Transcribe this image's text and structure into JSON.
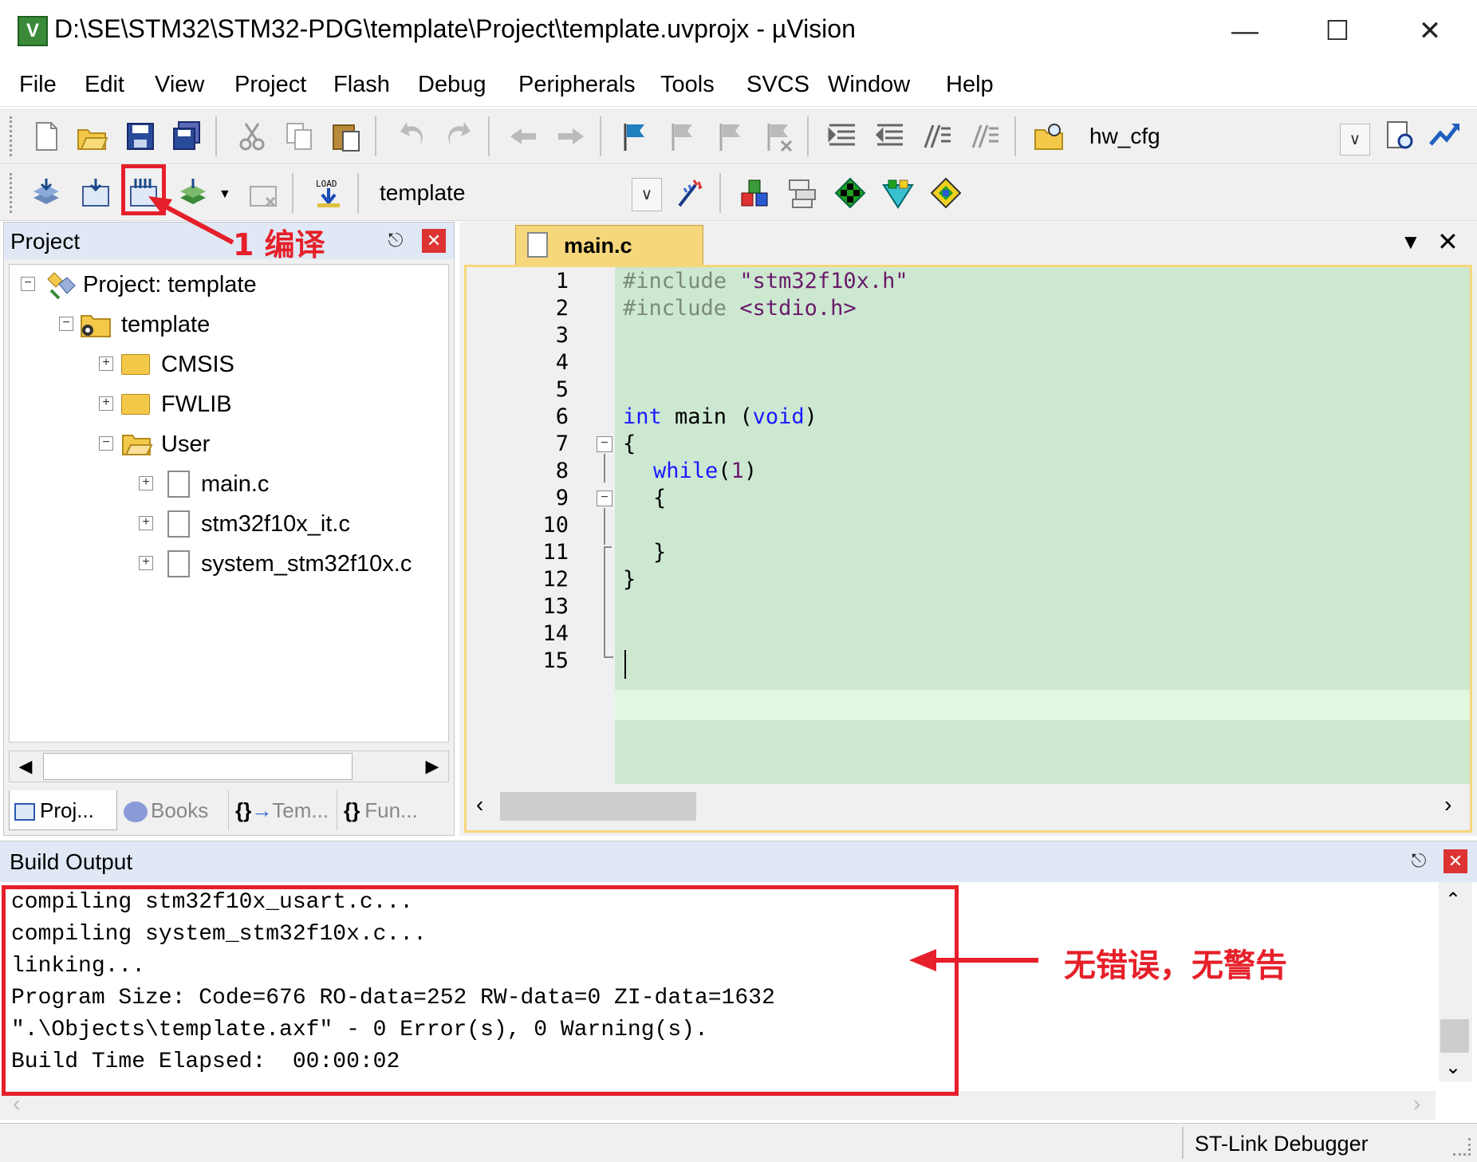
{
  "window": {
    "title": "D:\\SE\\STM32\\STM32-PDG\\template\\Project\\template.uvprojx - µVision",
    "minimize": "—",
    "maximize": "☐",
    "close": "✕"
  },
  "menu": [
    "File",
    "Edit",
    "View",
    "Project",
    "Flash",
    "Debug",
    "Peripherals",
    "Tools",
    "SVCS",
    "Window",
    "Help"
  ],
  "toolbar": {
    "find_combo_value": "hw_cfg",
    "target_combo_value": "template"
  },
  "project_panel": {
    "title": "Project",
    "tree": [
      {
        "label": "Project: template",
        "level": 0,
        "type": "project",
        "expander": "−"
      },
      {
        "label": "template",
        "level": 1,
        "type": "target",
        "expander": "−"
      },
      {
        "label": "CMSIS",
        "level": 2,
        "type": "folder",
        "expander": "+"
      },
      {
        "label": "FWLIB",
        "level": 2,
        "type": "folder",
        "expander": "+"
      },
      {
        "label": "User",
        "level": 2,
        "type": "folder-open",
        "expander": "−"
      },
      {
        "label": "main.c",
        "level": 3,
        "type": "file",
        "expander": "+"
      },
      {
        "label": "stm32f10x_it.c",
        "level": 3,
        "type": "file",
        "expander": "+"
      },
      {
        "label": "system_stm32f10x.c",
        "level": 3,
        "type": "file",
        "expander": "+"
      }
    ],
    "tabs": [
      {
        "label": "Proj..."
      },
      {
        "label": "Books"
      },
      {
        "label": "Tem..."
      },
      {
        "label": "Fun..."
      }
    ]
  },
  "editor": {
    "tab_label": "main.c",
    "line_numbers": [
      "1",
      "2",
      "3",
      "4",
      "5",
      "6",
      "7",
      "8",
      "9",
      "10",
      "11",
      "12",
      "13",
      "14",
      "15"
    ],
    "code": {
      "l1_pre": "#include ",
      "l1_str": "\"stm32f10x.h\"",
      "l2_pre": "#include ",
      "l2_str": "<stdio.h>",
      "l6_kw": "int",
      "l6_mid": " main ",
      "l6_paren_open": "(",
      "l6_void": "void",
      "l6_paren_close": ")",
      "l7": "{",
      "l8_kw": "while",
      "l8_open": "(",
      "l8_num": "1",
      "l8_close": ")",
      "l9": "{",
      "l11": "}",
      "l12": "}"
    }
  },
  "build_output": {
    "title": "Build Output",
    "lines": [
      "compiling stm32f10x_usart.c...",
      "compiling system_stm32f10x.c...",
      "linking...",
      "Program Size: Code=676 RO-data=252 RW-data=0 ZI-data=1632",
      "\".\\Objects\\template.axf\" - 0 Error(s), 0 Warning(s).",
      "Build Time Elapsed:  00:00:02"
    ]
  },
  "status": {
    "debugger": "ST-Link Debugger"
  },
  "annotations": {
    "compile_label": "1 编译",
    "result_label": "无错误，无警告",
    "color": "#e5202a"
  }
}
